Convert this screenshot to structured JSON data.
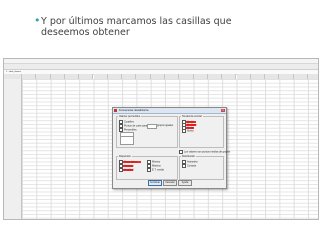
{
  "slide": {
    "bullet": "Y por últimos marcamos las casillas que deseemos obtener"
  },
  "spss": {
    "cell_ref": "1 : edad_alumno"
  },
  "dialog": {
    "title": "Frecuencias: Estadísticos",
    "percentile_group": "Valores percentiles",
    "opt_cuartiles": "Cuartiles",
    "opt_puntos_corte": "Puntos de corte para:",
    "opt_grupos_iguales": "grupos iguales",
    "opt_percentiles": "Percentiles:",
    "tendencia_group": "Tendencia central",
    "tendencia_items": [
      "Media",
      "Mediana",
      "Moda",
      "Suma"
    ],
    "valores_medio": "Los valores son puntos medios de grupos",
    "dispersion_group": "Dispersión",
    "dispersion_left": [
      "Desv. típica",
      "Varianza",
      "Amplitud"
    ],
    "dispersion_right": [
      "Mínimo",
      "Máximo",
      "E.T. media"
    ],
    "distribucion_group": "Distribución",
    "distribucion_items": [
      "Asimetría",
      "Curtosis"
    ],
    "btn_continuar": "Continuar",
    "btn_cancelar": "Cancelar",
    "btn_ayuda": "Ayuda"
  },
  "colors": {
    "bullet": "#2aa5b5",
    "highlight": "#e03030"
  }
}
